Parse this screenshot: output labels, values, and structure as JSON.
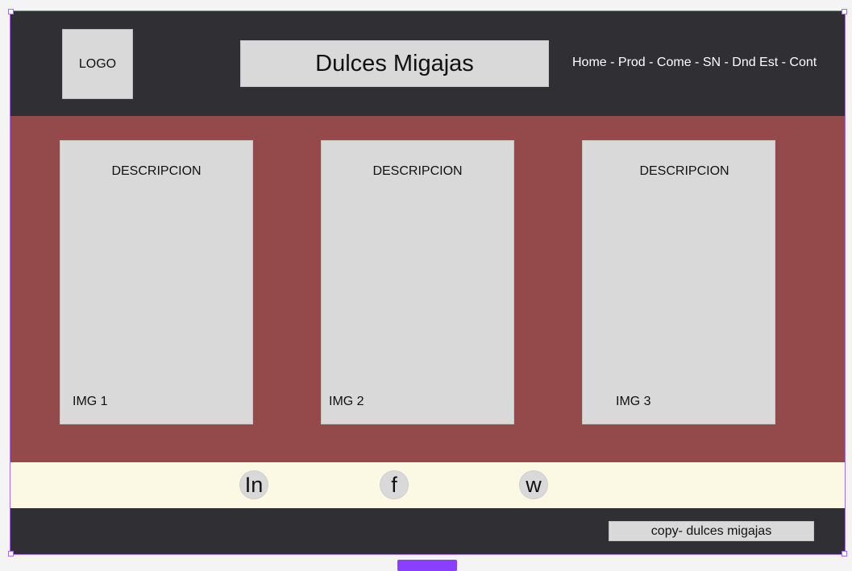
{
  "header": {
    "logo_label": "LOGO",
    "title": "Dulces Migajas",
    "nav": "Home - Prod - Come - SN - Dnd Est - Cont"
  },
  "cards": [
    {
      "description": "DESCRIPCION",
      "image_label": "IMG 1"
    },
    {
      "description": "DESCRIPCION",
      "image_label": "IMG 2"
    },
    {
      "description": "DESCRIPCION",
      "image_label": "IMG 3"
    }
  ],
  "social": {
    "linkedin": "In",
    "facebook": "f",
    "whatsapp": "w"
  },
  "footer": {
    "copy": "copy- dulces migajas"
  },
  "colors": {
    "header_bg": "#302f34",
    "main_bg": "#944a4b",
    "social_bg": "#fbf8e4",
    "placeholder_gray": "#d9d9d9"
  }
}
